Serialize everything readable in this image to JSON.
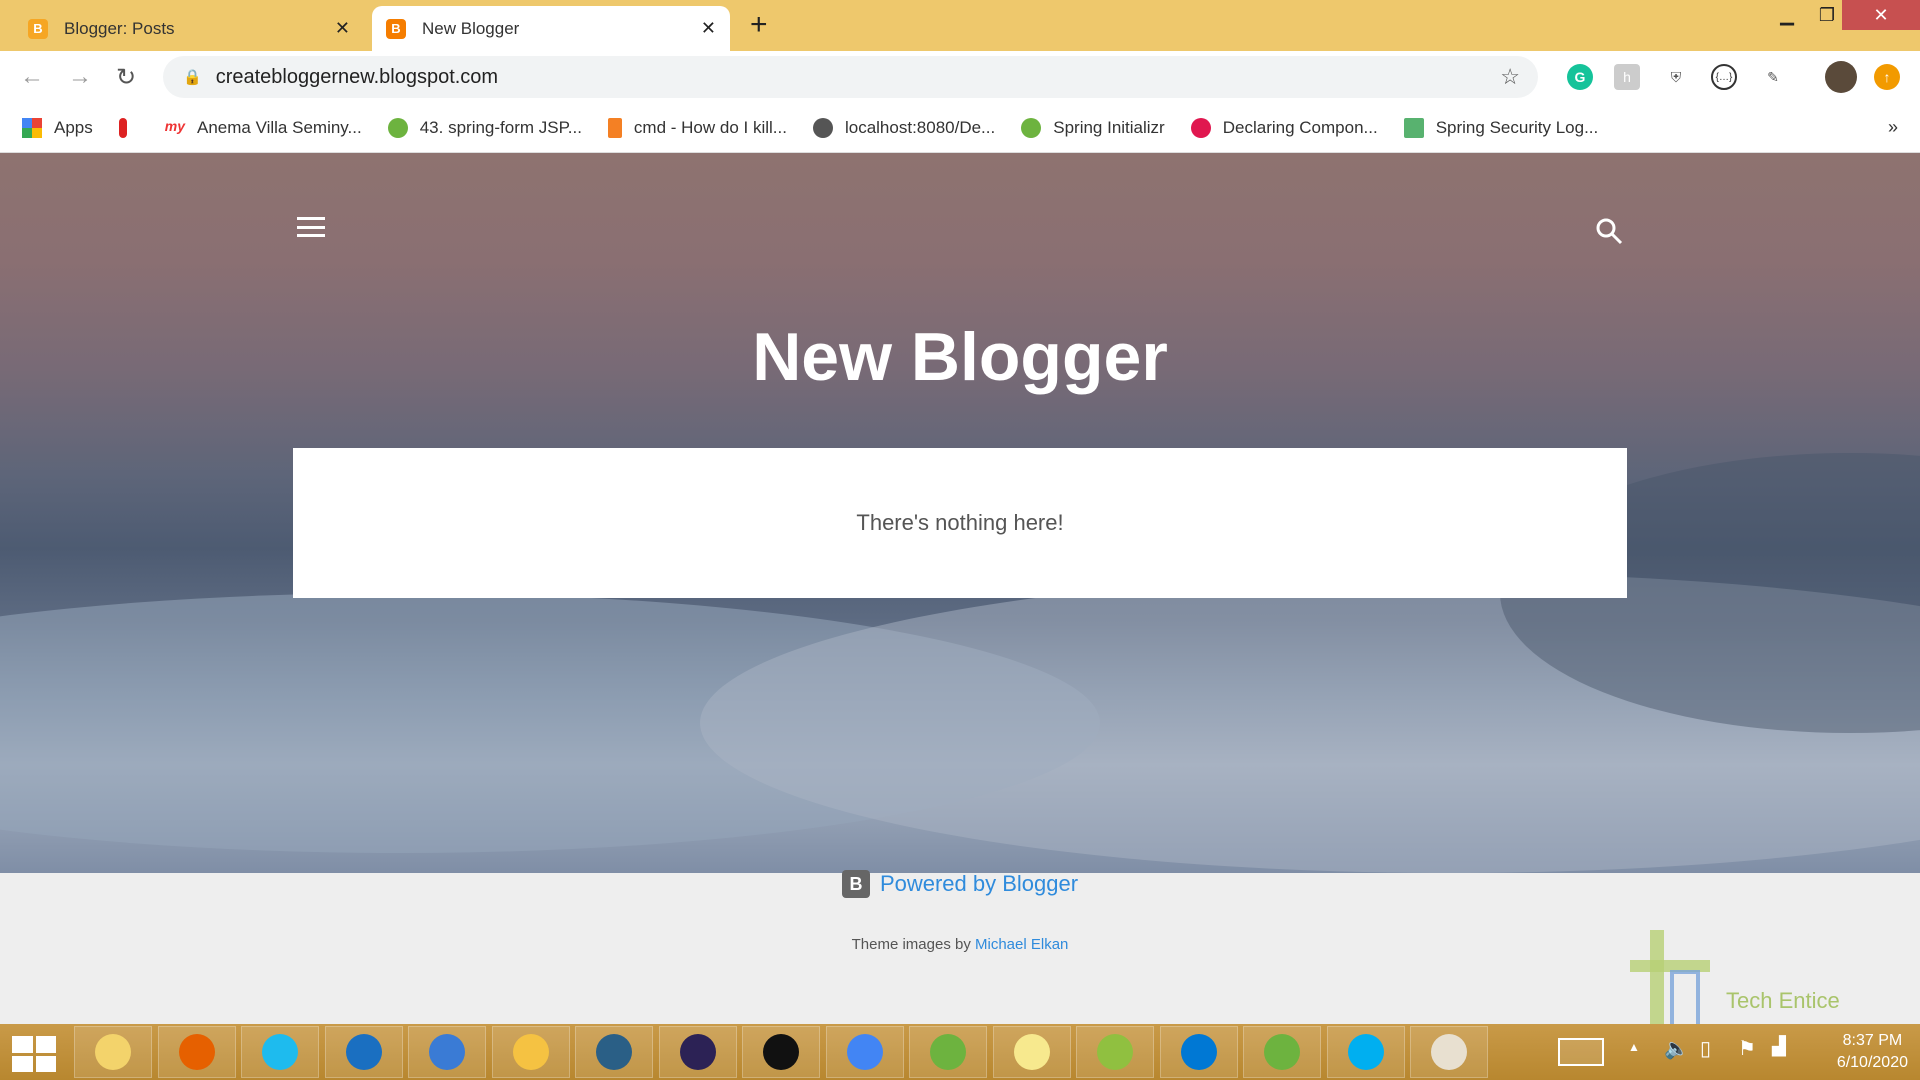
{
  "browser": {
    "tabs": [
      {
        "title": "Blogger: Posts",
        "icon": "blogger-icon",
        "active": false
      },
      {
        "title": "New Blogger",
        "icon": "blogger-icon",
        "active": true
      }
    ],
    "url": "createbloggernew.blogspot.com",
    "bookmarks": [
      {
        "label": "Apps",
        "icon": "apps-grid-icon"
      },
      {
        "label": "",
        "icon": "flame-icon"
      },
      {
        "label": "Anema Villa Seminy...",
        "icon": "my-logo-icon"
      },
      {
        "label": "43. spring-form JSP...",
        "icon": "spring-icon"
      },
      {
        "label": "cmd - How do I kill...",
        "icon": "stackoverflow-icon"
      },
      {
        "label": "localhost:8080/De...",
        "icon": "globe-icon"
      },
      {
        "label": "Spring Initializr",
        "icon": "spring-icon"
      },
      {
        "label": "Declaring Compon...",
        "icon": "play-icon"
      },
      {
        "label": "Spring Security Log...",
        "icon": "leaf-icon"
      }
    ],
    "more_bookmarks": "»",
    "colors": {
      "tabbar": "#eec86c",
      "close": "#c75050"
    }
  },
  "blog": {
    "title": "New Blogger",
    "empty_message": "There's nothing here!",
    "powered_by": "Powered by Blogger",
    "theme_prefix": "Theme images by",
    "theme_author": "Michael Elkan",
    "link_color": "#2f8bdc"
  },
  "watermark": "Tech Entice",
  "taskbar": {
    "apps": [
      "file-explorer",
      "firefox",
      "internet-explorer",
      "thunderbird",
      "remote-desktop",
      "tools",
      "mysql-workbench",
      "eclipse",
      "cmd",
      "chrome",
      "spring-tool-suite",
      "sticky-notes",
      "notepad-plus-plus",
      "vscode",
      "spring-tool-suite-2",
      "skype",
      "paint"
    ],
    "time": "8:37 PM",
    "date": "6/10/2020"
  }
}
